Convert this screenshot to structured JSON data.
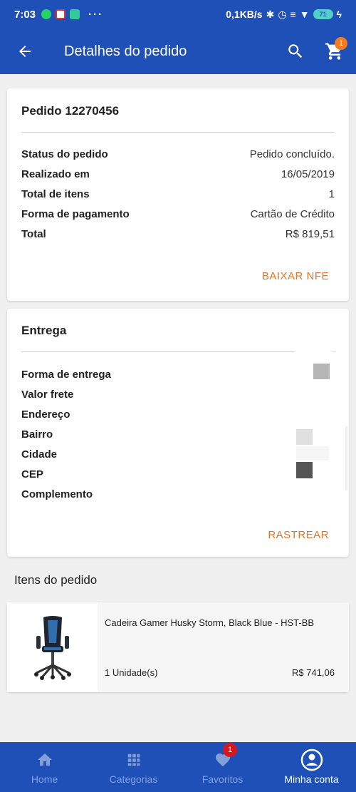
{
  "status_bar": {
    "time": "7:03",
    "dots": "···",
    "network_speed": "0,1KB/s",
    "battery": "71"
  },
  "header": {
    "title": "Detalhes do pedido",
    "cart_count": "1"
  },
  "order": {
    "title": "Pedido 12270456",
    "rows": [
      {
        "label": "Status do pedido",
        "value": "Pedido concluído."
      },
      {
        "label": "Realizado em",
        "value": "16/05/2019"
      },
      {
        "label": "Total de itens",
        "value": "1"
      },
      {
        "label": "Forma de pagamento",
        "value": "Cartão de Crédito"
      },
      {
        "label": "Total",
        "value": "R$ 819,51"
      }
    ],
    "action_label": "BAIXAR NFE"
  },
  "delivery": {
    "title": "Entrega",
    "rows": [
      {
        "label": "Forma de entrega"
      },
      {
        "label": "Valor frete"
      },
      {
        "label": "Endereço"
      },
      {
        "label": "Bairro"
      },
      {
        "label": "Cidade"
      },
      {
        "label": "CEP"
      },
      {
        "label": "Complemento"
      }
    ],
    "action_label": "RASTREAR"
  },
  "items_section": {
    "title": "Itens do pedido",
    "items": [
      {
        "name": "Cadeira Gamer Husky Storm, Black Blue - HST-BB",
        "quantity": "1  Unidade(s)",
        "price": "R$ 741,06"
      }
    ]
  },
  "bottom_nav": {
    "items": [
      {
        "label": "Home"
      },
      {
        "label": "Categorias"
      },
      {
        "label": "Favoritos",
        "badge": "1"
      },
      {
        "label": "Minha conta"
      }
    ]
  },
  "colors": {
    "primary": "#1e50b8",
    "accent": "#e3752b",
    "badge_red": "#d3181e",
    "badge_orange": "#f47b20"
  }
}
